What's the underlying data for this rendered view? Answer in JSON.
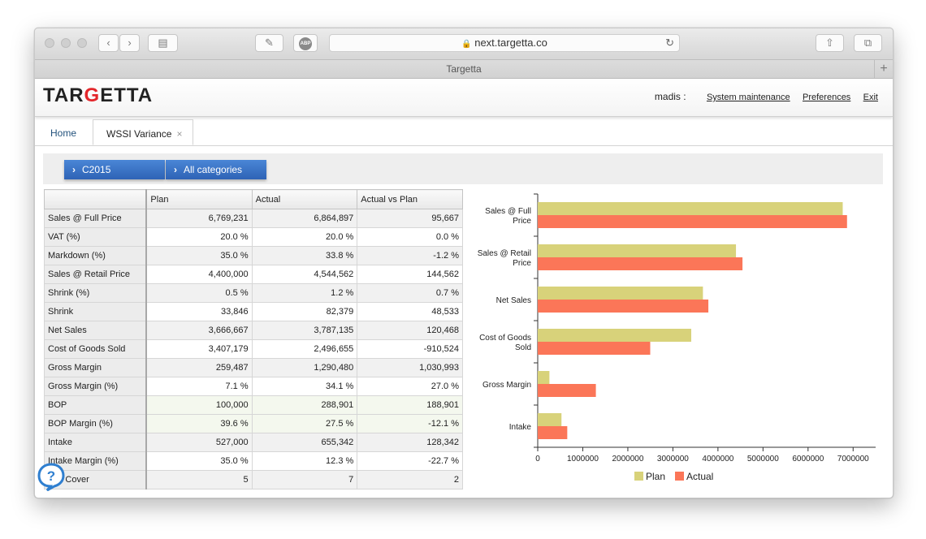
{
  "browser": {
    "url": "next.targetta.co",
    "tab_title": "Targetta",
    "adblock_label": "ABP"
  },
  "app": {
    "logo_prefix": "TAR",
    "logo_accent": "G",
    "logo_suffix": "ETTA",
    "user": "madis :",
    "links": [
      "System maintenance",
      "Preferences",
      "Exit"
    ]
  },
  "tabs": [
    {
      "label": "Home"
    },
    {
      "label": "WSSI Variance",
      "close": "×"
    }
  ],
  "filters": [
    "C2015",
    "All categories"
  ],
  "table": {
    "headers": [
      "",
      "Plan",
      "Actual",
      "Actual vs Plan"
    ],
    "rows": [
      {
        "label": "Sales @ Full Price",
        "plan": "6,769,231",
        "actual": "6,864,897",
        "diff": "95,667"
      },
      {
        "label": "VAT (%)",
        "plan": "20.0 %",
        "actual": "20.0 %",
        "diff": "0.0 %"
      },
      {
        "label": "Markdown (%)",
        "plan": "35.0 %",
        "actual": "33.8 %",
        "diff": "-1.2 %"
      },
      {
        "label": "Sales @ Retail Price",
        "plan": "4,400,000",
        "actual": "4,544,562",
        "diff": "144,562"
      },
      {
        "label": "Shrink (%)",
        "plan": "0.5 %",
        "actual": "1.2 %",
        "diff": "0.7 %"
      },
      {
        "label": "Shrink",
        "plan": "33,846",
        "actual": "82,379",
        "diff": "48,533"
      },
      {
        "label": "Net Sales",
        "plan": "3,666,667",
        "actual": "3,787,135",
        "diff": "120,468"
      },
      {
        "label": "Cost of Goods Sold",
        "plan": "3,407,179",
        "actual": "2,496,655",
        "diff": "-910,524"
      },
      {
        "label": "Gross Margin",
        "plan": "259,487",
        "actual": "1,290,480",
        "diff": "1,030,993"
      },
      {
        "label": "Gross Margin (%)",
        "plan": "7.1 %",
        "actual": "34.1 %",
        "diff": "27.0 %"
      },
      {
        "label": "BOP",
        "plan": "100,000",
        "actual": "288,901",
        "diff": "188,901"
      },
      {
        "label": "BOP Margin (%)",
        "plan": "39.6 %",
        "actual": "27.5 %",
        "diff": "-12.1 %"
      },
      {
        "label": "Intake",
        "plan": "527,000",
        "actual": "655,342",
        "diff": "128,342"
      },
      {
        "label": "Intake Margin (%)",
        "plan": "35.0 %",
        "actual": "12.3 %",
        "diff": "-22.7 %"
      },
      {
        "label": "Flat Cover",
        "plan": "5",
        "actual": "7",
        "diff": "2"
      }
    ]
  },
  "chart_data": {
    "type": "bar",
    "orientation": "horizontal",
    "categories": [
      [
        "Sales @ Full",
        "Price"
      ],
      [
        "Sales @ Retail",
        "Price"
      ],
      [
        "Net Sales"
      ],
      [
        "Cost of Goods",
        "Sold"
      ],
      [
        "Gross Margin"
      ],
      [
        "Intake"
      ]
    ],
    "series": [
      {
        "name": "Plan",
        "color": "#d8d27a",
        "values": [
          6769231,
          4400000,
          3666667,
          3407179,
          259487,
          527000
        ]
      },
      {
        "name": "Actual",
        "color": "#fb7658",
        "values": [
          6864897,
          4544562,
          3787135,
          2496655,
          1290480,
          655342
        ]
      }
    ],
    "xlim": [
      0,
      7500000
    ],
    "xticks": [
      0,
      1000000,
      2000000,
      3000000,
      4000000,
      5000000,
      6000000,
      7000000
    ],
    "legend": "bottom"
  },
  "colors": {
    "accent": "#2e63b6",
    "logo_red": "#e3262b"
  }
}
